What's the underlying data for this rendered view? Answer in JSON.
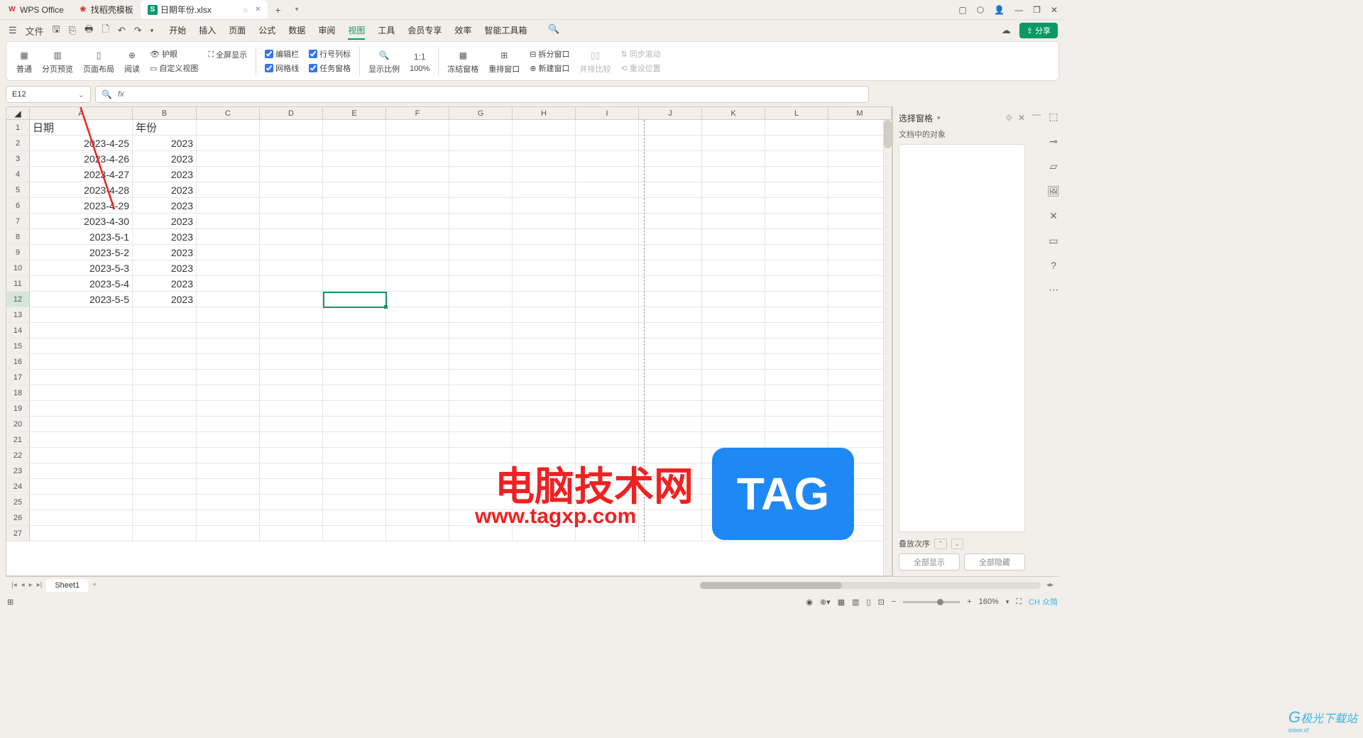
{
  "titlebar": {
    "tabs": [
      {
        "icon": "W",
        "label": "WPS Office"
      },
      {
        "icon": "稻",
        "label": "找稻壳模板"
      },
      {
        "icon": "S",
        "label": "日期年份.xlsx"
      }
    ],
    "circle": "○",
    "add": "+"
  },
  "menubar": {
    "file": "文件",
    "tabs": [
      "开始",
      "插入",
      "页面",
      "公式",
      "数据",
      "审阅",
      "视图",
      "工具",
      "会员专享",
      "效率",
      "智能工具箱"
    ],
    "active": "视图",
    "share": "分享"
  },
  "ribbon": {
    "normal": "普通",
    "pagebreak": "分页预览",
    "pagelayout": "页面布局",
    "reading": "阅读",
    "eyecare": "护眼",
    "fullscreen": "全屏显示",
    "customview": "自定义视图",
    "editbar": "编辑栏",
    "rowcol": "行号列标",
    "gridlines": "网格线",
    "taskpane": "任务窗格",
    "zoom": "显示比例",
    "hundred": "100%",
    "freeze": "冻结窗格",
    "arrange": "重排窗口",
    "split": "拆分窗口",
    "newwin": "新建窗口",
    "sidebyside": "并排比较",
    "syncscroll": "同步滚动",
    "resetpos": "重设位置"
  },
  "formulabar": {
    "cellref": "E12",
    "fx": "fx"
  },
  "columns": [
    "A",
    "B",
    "C",
    "D",
    "E",
    "F",
    "G",
    "H",
    "I",
    "J",
    "K",
    "L",
    "M"
  ],
  "headers": {
    "a": "日期",
    "b": "年份"
  },
  "rows": [
    {
      "n": "1",
      "a": "日期",
      "b": "年份",
      "header": true
    },
    {
      "n": "2",
      "a": "2023-4-25",
      "b": "2023"
    },
    {
      "n": "3",
      "a": "2023-4-26",
      "b": "2023"
    },
    {
      "n": "4",
      "a": "2023-4-27",
      "b": "2023"
    },
    {
      "n": "5",
      "a": "2023-4-28",
      "b": "2023"
    },
    {
      "n": "6",
      "a": "2023-4-29",
      "b": "2023"
    },
    {
      "n": "7",
      "a": "2023-4-30",
      "b": "2023"
    },
    {
      "n": "8",
      "a": "2023-5-1",
      "b": "2023"
    },
    {
      "n": "9",
      "a": "2023-5-2",
      "b": "2023"
    },
    {
      "n": "10",
      "a": "2023-5-3",
      "b": "2023"
    },
    {
      "n": "11",
      "a": "2023-5-4",
      "b": "2023"
    },
    {
      "n": "12",
      "a": "2023-5-5",
      "b": "2023"
    }
  ],
  "emptyrows": [
    "13",
    "14",
    "15",
    "16",
    "17",
    "18",
    "19",
    "20",
    "21",
    "22",
    "23",
    "24",
    "25",
    "26",
    "27"
  ],
  "rightpanel": {
    "title": "选择窗格",
    "sub": "文档中的对象",
    "footer": "叠放次序",
    "btn1": "全部显示",
    "btn2": "全部隐藏"
  },
  "sheettabs": {
    "sheet": "Sheet1"
  },
  "statusbar": {
    "zoom": "160%",
    "ime": "CH 众简"
  },
  "watermarks": {
    "title": "电脑技术网",
    "url": "www.tagxp.com",
    "tag": "TAG",
    "jiguang": "极光下载站"
  }
}
